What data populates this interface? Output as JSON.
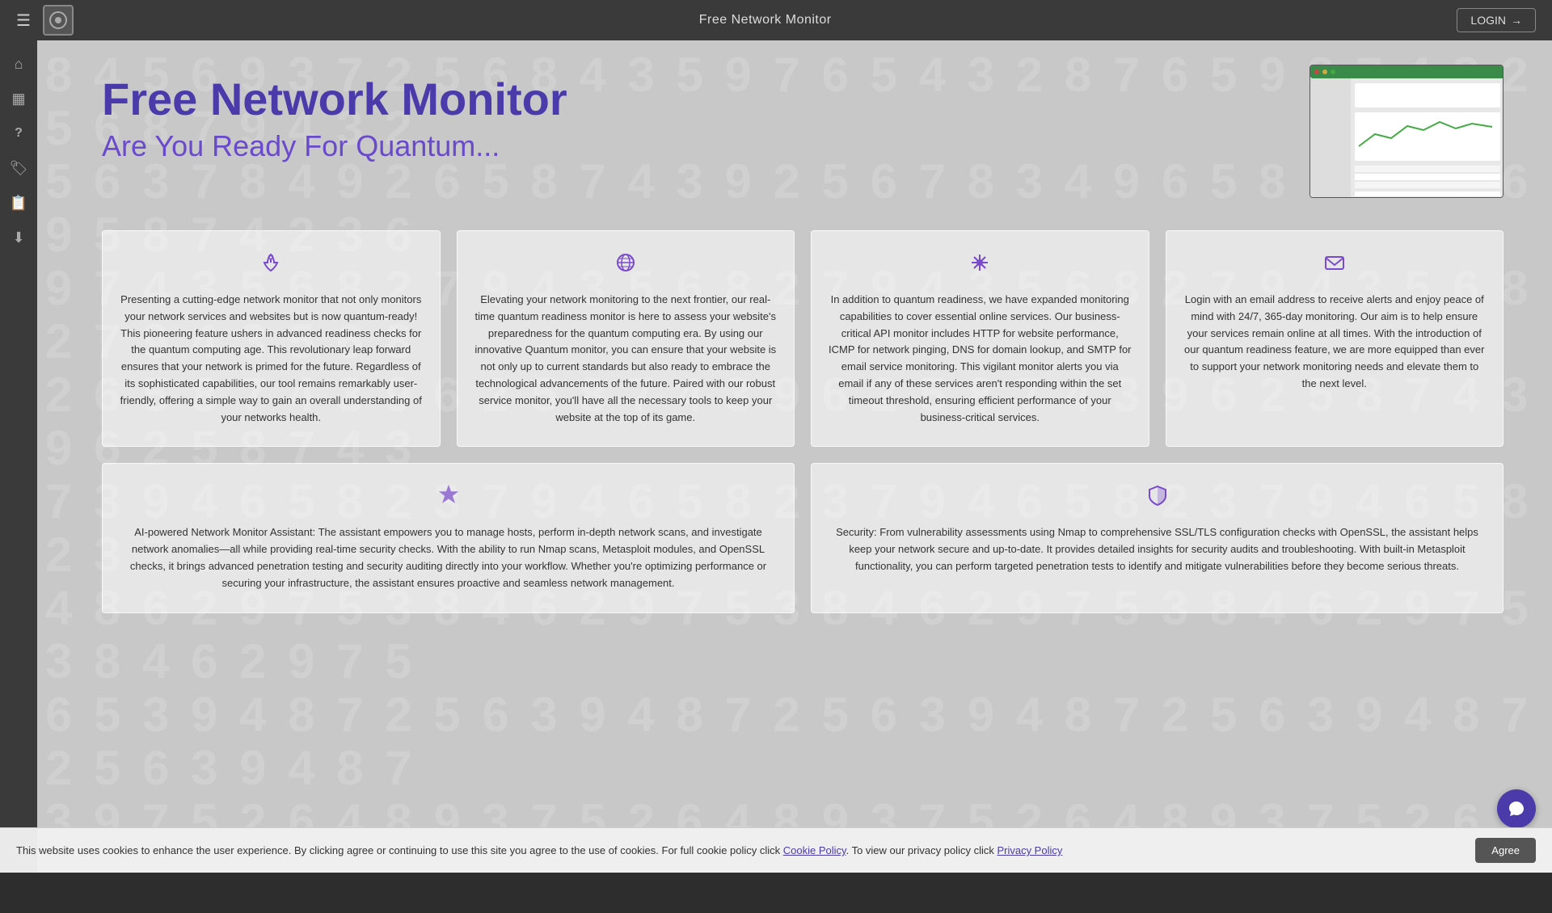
{
  "topnav": {
    "title": "Free Network Monitor",
    "login_label": "LOGIN"
  },
  "sidebar": {
    "items": [
      {
        "id": "home",
        "icon": "🏠",
        "label": "Home"
      },
      {
        "id": "dashboard",
        "icon": "▦",
        "label": "Dashboard"
      },
      {
        "id": "help",
        "icon": "?",
        "label": "Help"
      },
      {
        "id": "tags",
        "icon": "🏷",
        "label": "Tags"
      },
      {
        "id": "saved",
        "icon": "📋",
        "label": "Saved"
      },
      {
        "id": "download",
        "icon": "⬇",
        "label": "Download"
      }
    ]
  },
  "hero": {
    "title": "Free Network Monitor",
    "subtitle": "Are You Ready For Quantum..."
  },
  "cards": [
    {
      "id": "network-monitor",
      "icon": "anchor",
      "text": "Presenting a cutting-edge network monitor that not only monitors your network services and websites but is now quantum-ready! This pioneering feature ushers in advanced readiness checks for the quantum computing age. This revolutionary leap forward ensures that your network is primed for the future. Regardless of its sophisticated capabilities, our tool remains remarkably user-friendly, offering a simple way to gain an overall understanding of your networks health."
    },
    {
      "id": "quantum-readiness",
      "icon": "globe",
      "text": "Elevating your network monitoring to the next frontier, our real-time quantum readiness monitor is here to assess your website's preparedness for the quantum computing era. By using our innovative Quantum monitor, you can ensure that your website is not only up to current standards but also ready to embrace the technological advancements of the future. Paired with our robust service monitor, you'll have all the necessary tools to keep your website at the top of its game."
    },
    {
      "id": "api-monitor",
      "icon": "asterisk",
      "text": "In addition to quantum readiness, we have expanded monitoring capabilities to cover essential online services. Our business-critical API monitor includes HTTP for website performance, ICMP for network pinging, DNS for domain lookup, and SMTP for email service monitoring. This vigilant monitor alerts you via email if any of these services aren't responding within the set timeout threshold, ensuring efficient performance of your business-critical services."
    },
    {
      "id": "email-alerts",
      "icon": "email",
      "text": "Login with an email address to receive alerts and enjoy peace of mind with 24/7, 365-day monitoring. Our aim is to help ensure your services remain online at all times. With the introduction of our quantum readiness feature, we are more equipped than ever to support your network monitoring needs and elevate them to the next level."
    }
  ],
  "cards2": [
    {
      "id": "ai-assistant",
      "icon": "star-shield",
      "text": "AI-powered Network Monitor Assistant: The assistant empowers you to manage hosts, perform in-depth network scans, and investigate network anomalies—all while providing real-time security checks. With the ability to run Nmap scans, Metasploit modules, and OpenSSL checks, it brings advanced penetration testing and security auditing directly into your workflow. Whether you're optimizing performance or securing your infrastructure, the assistant ensures proactive and seamless network management."
    },
    {
      "id": "security",
      "icon": "shield",
      "text": "Security: From vulnerability assessments using Nmap to comprehensive SSL/TLS configuration checks with OpenSSL, the assistant helps keep your network secure and up-to-date. It provides detailed insights for security audits and troubleshooting. With built-in Metasploit functionality, you can perform targeted penetration tests to identify and mitigate vulnerabilities before they become serious threats."
    }
  ],
  "cookie": {
    "text": "This website uses cookies to enhance the user experience. By clicking agree or continuing to use this site you agree to the use of cookies. For full cookie policy click ",
    "cookie_link": "Cookie Policy",
    "privacy_text": ". To view our privacy policy click ",
    "privacy_link": "Privacy Policy",
    "agree_label": "Agree"
  },
  "bg_numbers": "4 8 7 5 6 9 3 2 5 6 7 8 4 3 5 9 8 7 6 5 4 3 2 1 8 7 6 5 9 8 7 4 3 2 5 6 8 7 9 4 3 2 1 6 5 4 8 7 9 3 2",
  "colors": {
    "accent": "#4a3aaa",
    "accent_light": "#6a4acc",
    "icon_color": "#7a4acc"
  }
}
